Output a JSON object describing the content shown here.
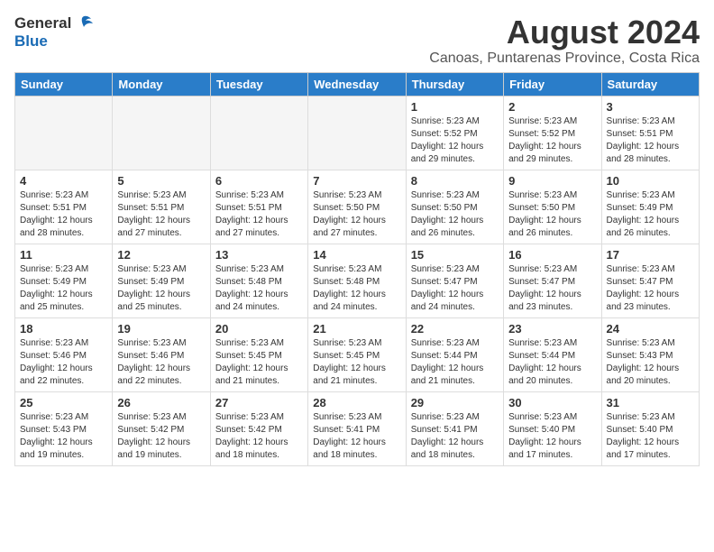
{
  "header": {
    "logo_general": "General",
    "logo_blue": "Blue",
    "title": "August 2024",
    "subtitle": "Canoas, Puntarenas Province, Costa Rica"
  },
  "weekdays": [
    "Sunday",
    "Monday",
    "Tuesday",
    "Wednesday",
    "Thursday",
    "Friday",
    "Saturday"
  ],
  "weeks": [
    [
      {
        "day": "",
        "info": ""
      },
      {
        "day": "",
        "info": ""
      },
      {
        "day": "",
        "info": ""
      },
      {
        "day": "",
        "info": ""
      },
      {
        "day": "1",
        "info": "Sunrise: 5:23 AM\nSunset: 5:52 PM\nDaylight: 12 hours\nand 29 minutes."
      },
      {
        "day": "2",
        "info": "Sunrise: 5:23 AM\nSunset: 5:52 PM\nDaylight: 12 hours\nand 29 minutes."
      },
      {
        "day": "3",
        "info": "Sunrise: 5:23 AM\nSunset: 5:51 PM\nDaylight: 12 hours\nand 28 minutes."
      }
    ],
    [
      {
        "day": "4",
        "info": "Sunrise: 5:23 AM\nSunset: 5:51 PM\nDaylight: 12 hours\nand 28 minutes."
      },
      {
        "day": "5",
        "info": "Sunrise: 5:23 AM\nSunset: 5:51 PM\nDaylight: 12 hours\nand 27 minutes."
      },
      {
        "day": "6",
        "info": "Sunrise: 5:23 AM\nSunset: 5:51 PM\nDaylight: 12 hours\nand 27 minutes."
      },
      {
        "day": "7",
        "info": "Sunrise: 5:23 AM\nSunset: 5:50 PM\nDaylight: 12 hours\nand 27 minutes."
      },
      {
        "day": "8",
        "info": "Sunrise: 5:23 AM\nSunset: 5:50 PM\nDaylight: 12 hours\nand 26 minutes."
      },
      {
        "day": "9",
        "info": "Sunrise: 5:23 AM\nSunset: 5:50 PM\nDaylight: 12 hours\nand 26 minutes."
      },
      {
        "day": "10",
        "info": "Sunrise: 5:23 AM\nSunset: 5:49 PM\nDaylight: 12 hours\nand 26 minutes."
      }
    ],
    [
      {
        "day": "11",
        "info": "Sunrise: 5:23 AM\nSunset: 5:49 PM\nDaylight: 12 hours\nand 25 minutes."
      },
      {
        "day": "12",
        "info": "Sunrise: 5:23 AM\nSunset: 5:49 PM\nDaylight: 12 hours\nand 25 minutes."
      },
      {
        "day": "13",
        "info": "Sunrise: 5:23 AM\nSunset: 5:48 PM\nDaylight: 12 hours\nand 24 minutes."
      },
      {
        "day": "14",
        "info": "Sunrise: 5:23 AM\nSunset: 5:48 PM\nDaylight: 12 hours\nand 24 minutes."
      },
      {
        "day": "15",
        "info": "Sunrise: 5:23 AM\nSunset: 5:47 PM\nDaylight: 12 hours\nand 24 minutes."
      },
      {
        "day": "16",
        "info": "Sunrise: 5:23 AM\nSunset: 5:47 PM\nDaylight: 12 hours\nand 23 minutes."
      },
      {
        "day": "17",
        "info": "Sunrise: 5:23 AM\nSunset: 5:47 PM\nDaylight: 12 hours\nand 23 minutes."
      }
    ],
    [
      {
        "day": "18",
        "info": "Sunrise: 5:23 AM\nSunset: 5:46 PM\nDaylight: 12 hours\nand 22 minutes."
      },
      {
        "day": "19",
        "info": "Sunrise: 5:23 AM\nSunset: 5:46 PM\nDaylight: 12 hours\nand 22 minutes."
      },
      {
        "day": "20",
        "info": "Sunrise: 5:23 AM\nSunset: 5:45 PM\nDaylight: 12 hours\nand 21 minutes."
      },
      {
        "day": "21",
        "info": "Sunrise: 5:23 AM\nSunset: 5:45 PM\nDaylight: 12 hours\nand 21 minutes."
      },
      {
        "day": "22",
        "info": "Sunrise: 5:23 AM\nSunset: 5:44 PM\nDaylight: 12 hours\nand 21 minutes."
      },
      {
        "day": "23",
        "info": "Sunrise: 5:23 AM\nSunset: 5:44 PM\nDaylight: 12 hours\nand 20 minutes."
      },
      {
        "day": "24",
        "info": "Sunrise: 5:23 AM\nSunset: 5:43 PM\nDaylight: 12 hours\nand 20 minutes."
      }
    ],
    [
      {
        "day": "25",
        "info": "Sunrise: 5:23 AM\nSunset: 5:43 PM\nDaylight: 12 hours\nand 19 minutes."
      },
      {
        "day": "26",
        "info": "Sunrise: 5:23 AM\nSunset: 5:42 PM\nDaylight: 12 hours\nand 19 minutes."
      },
      {
        "day": "27",
        "info": "Sunrise: 5:23 AM\nSunset: 5:42 PM\nDaylight: 12 hours\nand 18 minutes."
      },
      {
        "day": "28",
        "info": "Sunrise: 5:23 AM\nSunset: 5:41 PM\nDaylight: 12 hours\nand 18 minutes."
      },
      {
        "day": "29",
        "info": "Sunrise: 5:23 AM\nSunset: 5:41 PM\nDaylight: 12 hours\nand 18 minutes."
      },
      {
        "day": "30",
        "info": "Sunrise: 5:23 AM\nSunset: 5:40 PM\nDaylight: 12 hours\nand 17 minutes."
      },
      {
        "day": "31",
        "info": "Sunrise: 5:23 AM\nSunset: 5:40 PM\nDaylight: 12 hours\nand 17 minutes."
      }
    ]
  ]
}
